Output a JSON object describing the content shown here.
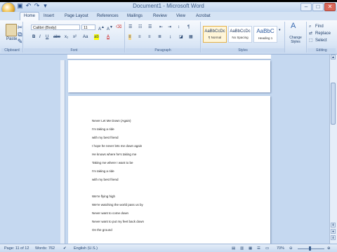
{
  "window": {
    "title": "Document1 - Microsoft Word"
  },
  "tabs": [
    "Home",
    "Insert",
    "Page Layout",
    "References",
    "Mailings",
    "Review",
    "View",
    "Acrobat"
  ],
  "ribbon": {
    "clipboard": {
      "label": "Clipboard",
      "paste": "Paste"
    },
    "font": {
      "label": "Font",
      "font_name": "Calibri (Body)",
      "font_size": "11"
    },
    "paragraph": {
      "label": "Paragraph"
    },
    "styles": {
      "label": "Styles",
      "items": [
        {
          "sample": "AaBbCcDc",
          "name": "¶ Normal"
        },
        {
          "sample": "AaBbCcDc",
          "name": "No Spacing"
        },
        {
          "sample": "AaBbC",
          "name": "Heading 1"
        }
      ],
      "change_styles": "Change Styles"
    },
    "editing": {
      "label": "Editing",
      "find": "Find",
      "replace": "Replace",
      "select": "Select"
    }
  },
  "document": {
    "lines": [
      "Never Let Me Down (Again)",
      "I'm taking a ride",
      "with my best friend",
      "I hope he never lets me down again",
      "He knows where he's taking me",
      "Taking me where I want to be",
      "I'm taking a ride",
      "with my best friend",
      "",
      "We're flying high",
      "We're watching the world pass us by",
      "Never want to come down",
      "Never want to put my feet back down",
      "On the ground"
    ]
  },
  "status": {
    "page": "Page: 11 of 12",
    "words": "Words: 762",
    "language": "English (U.S.)",
    "zoom": "70%"
  }
}
